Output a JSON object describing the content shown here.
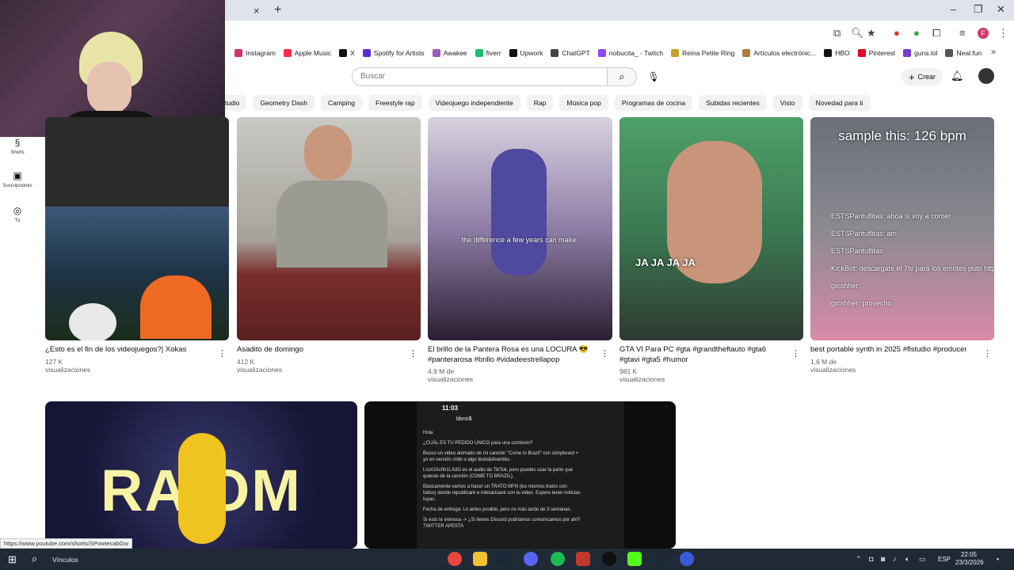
{
  "browser": {
    "tab_close": "×",
    "tab_new": "+",
    "window_controls": [
      "–",
      "❐",
      "✕"
    ],
    "profile_initial": "F",
    "bookmarks": [
      {
        "label": "Instagram",
        "color": "#d6336c"
      },
      {
        "label": "Apple Music",
        "color": "#fa2d48"
      },
      {
        "label": "X",
        "color": "#111111"
      },
      {
        "label": "Spotify for Artists",
        "color": "#5b2bd6"
      },
      {
        "label": "Awakee",
        "color": "#9a5bb7"
      },
      {
        "label": "fiverr",
        "color": "#1dbf73"
      },
      {
        "label": "Upwork",
        "color": "#111111"
      },
      {
        "label": "ChatGPT",
        "color": "#444444"
      },
      {
        "label": "nobucita_ - Twitch",
        "color": "#9146ff"
      },
      {
        "label": "Reina Petite Ring",
        "color": "#c9a227"
      },
      {
        "label": "Artículos electrónic...",
        "color": "#b07c3a"
      },
      {
        "label": "HBO",
        "color": "#111111"
      },
      {
        "label": "Pinterest",
        "color": "#e60023"
      },
      {
        "label": "guns.lol",
        "color": "#7a3bd1"
      },
      {
        "label": "Neal.fun",
        "color": "#555555"
      }
    ],
    "status_url": "https://www.youtube.com/shorts/SPowtecabGw"
  },
  "youtube": {
    "search_placeholder": "Buscar",
    "create_label": "Crear",
    "chips": [
      "tudio",
      "Geometry Dash",
      "Camping",
      "Freestyle rap",
      "Videojuego independiente",
      "Rap",
      "Música pop",
      "Programas de cocina",
      "Subidas recientes",
      "Visto",
      "Novedad para ti"
    ],
    "sidebar": [
      {
        "icon": "shorts-icon",
        "label": "Shorts"
      },
      {
        "icon": "subscriptions-icon",
        "label": "Suscripciones"
      },
      {
        "icon": "you-icon",
        "label": "Tú"
      }
    ],
    "shorts": [
      {
        "title": "¿Esto es el fin de los videojuegos?| Xokas",
        "views": "127 K visualizaciones"
      },
      {
        "title": "Asadito de domingo",
        "views": "412 K visualizaciones"
      },
      {
        "title": "El brillo de la Pantera Rosa es una LOCURA 😎 #panterarosa #brillo #vidadeestrellapop",
        "views": "4,9 M de visualizaciones"
      },
      {
        "title": "GTA VI Para PC #gta #grandtheftauto #gta6 #gtavi #gta5 #humor",
        "views": "981 K visualizaciones"
      },
      {
        "title": "best portable synth in 2025 #flstudio #producer",
        "views": "1,6 M de visualizaciones"
      }
    ],
    "overlays": {
      "caption_3": "the difference a few years can make",
      "laugh_4": "JA JA JA JA",
      "synth_title": "sample this: 126 bpm",
      "synth_chat": [
        "ESTSPantuflitas: ahoa si voy a comer",
        "ESTSPantuflitas: am",
        "ESTSPantuflitas:",
        "KickBot: descargate el 7tv para los emotes puto https://7tv.app/",
        "ginshher:",
        "ginshher: provecho"
      ],
      "random_text": "RA  OM",
      "phone_time": "11:03",
      "phone_contact": "bbno$",
      "phone_text": [
        "Hola",
        "¿CUÁL ES TU PEDIDO ÚNICO para una comisión?",
        "Busco un video animado de mi canción \"Come to Brazil\" con storyboard + yo en versión chibi o algo lindo&divertido.",
        "t.co/UXv0h1LXdG es el audio de TikTok, pero puedes usar la parte que quieras de la canción (COME TO BRAZIL).",
        "Básicamente vamos a hacer un TRATO MFN (los mismos tratos con todos) donde republicaré e interactuaré con tu video. Espero tener noticias tuyas.",
        "Fecha de entrega: Lo antes posible, pero no más tarde de 3 semanas.",
        "Si esto te interesa -> ¿Si tienes Discord podríamos comunicarnos por ahí? TWITTER APESTA"
      ]
    }
  },
  "taskbar": {
    "search_label": "Vínculos",
    "lang": "ESP",
    "time": "22:05",
    "date": "23/3/2026"
  }
}
